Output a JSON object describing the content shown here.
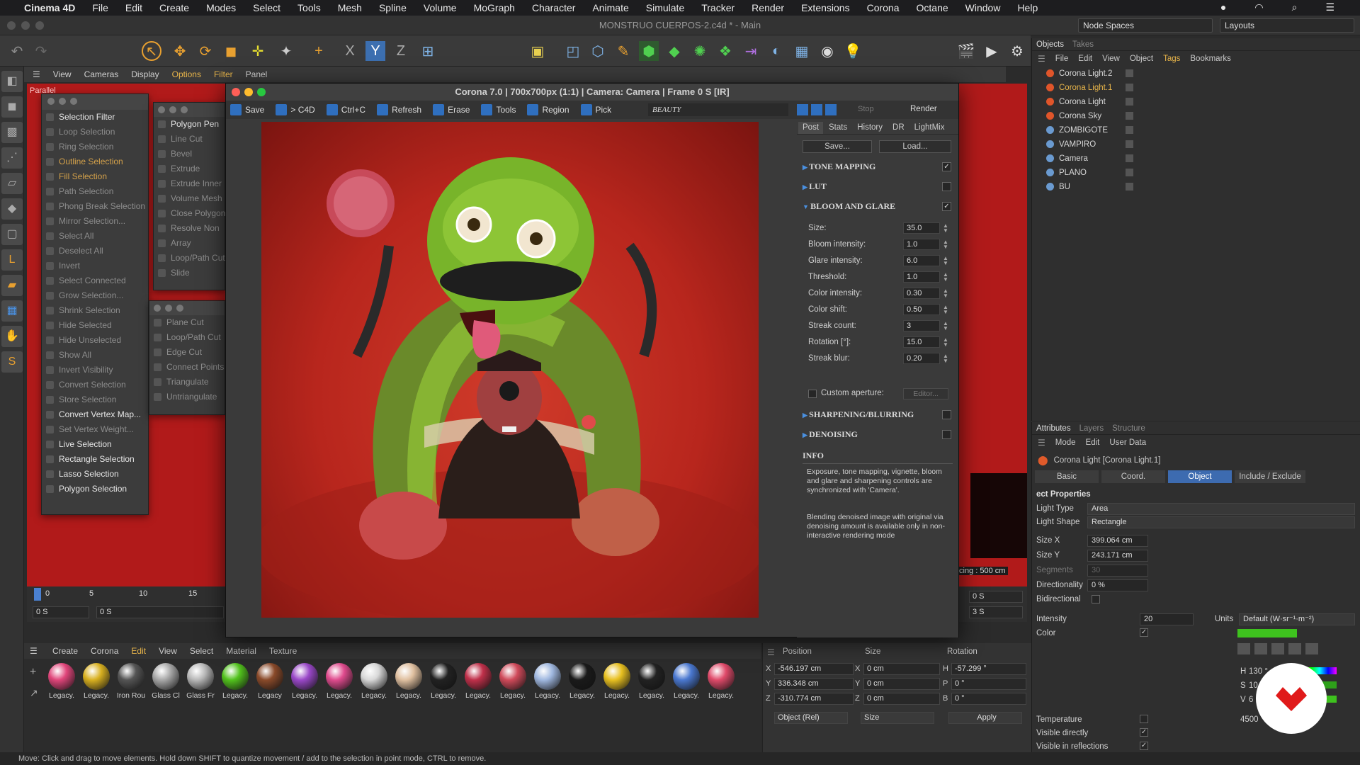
{
  "menubar": {
    "apple": "",
    "app": "Cinema 4D",
    "items": [
      "File",
      "Edit",
      "Create",
      "Modes",
      "Select",
      "Tools",
      "Mesh",
      "Spline",
      "Volume",
      "MoGraph",
      "Character",
      "Animate",
      "Simulate",
      "Tracker",
      "Render",
      "Extensions",
      "Corona",
      "Octane",
      "Window",
      "Help"
    ]
  },
  "window": {
    "title": "MONSTRUO CUERPOS-2.c4d * - Main",
    "node_spaces": "Node Spaces",
    "layouts": "Layouts"
  },
  "viewport_menu": [
    "View",
    "Cameras",
    "Display",
    "Options",
    "Filter",
    "Panel"
  ],
  "viewport": {
    "label": "Parallel",
    "grid_spacing": "cing : 500 cm"
  },
  "select_panel": {
    "items": [
      {
        "label": "Selection Filter",
        "state": "on"
      },
      {
        "label": "Loop Selection",
        "state": "off"
      },
      {
        "label": "Ring Selection",
        "state": "off"
      },
      {
        "label": "Outline Selection",
        "state": "hl"
      },
      {
        "label": "Fill Selection",
        "state": "hl"
      },
      {
        "label": "Path Selection",
        "state": "off"
      },
      {
        "label": "Phong Break Selection",
        "state": "off"
      },
      {
        "label": "Mirror Selection...",
        "state": "off"
      },
      {
        "label": "Select All",
        "state": "off"
      },
      {
        "label": "Deselect All",
        "state": "off"
      },
      {
        "label": "Invert",
        "state": "off"
      },
      {
        "label": "Select Connected",
        "state": "off"
      },
      {
        "label": "Grow Selection...",
        "state": "off"
      },
      {
        "label": "Shrink Selection",
        "state": "off"
      },
      {
        "label": "Hide Selected",
        "state": "off"
      },
      {
        "label": "Hide Unselected",
        "state": "off"
      },
      {
        "label": "Show All",
        "state": "off"
      },
      {
        "label": "Invert Visibility",
        "state": "off"
      },
      {
        "label": "Convert Selection",
        "state": "off"
      },
      {
        "label": "Store Selection",
        "state": "off"
      },
      {
        "label": "Convert Vertex Map...",
        "state": "on"
      },
      {
        "label": "Set Vertex Weight...",
        "state": "off"
      },
      {
        "label": "Live Selection",
        "state": "on"
      },
      {
        "label": "Rectangle Selection",
        "state": "on"
      },
      {
        "label": "Lasso Selection",
        "state": "on"
      },
      {
        "label": "Polygon Selection",
        "state": "on"
      }
    ]
  },
  "mesh_panel": {
    "items": [
      "Polygon Pen",
      "Line Cut",
      "Bevel",
      "Extrude",
      "Extrude Inner",
      "Volume Mesh",
      "Close Polygon",
      "Resolve Non",
      "Array",
      "Loop/Path Cut",
      "Slide"
    ]
  },
  "mesh_panel2": {
    "items": [
      "Plane Cut",
      "Loop/Path Cut",
      "Edge Cut",
      "Connect Points",
      "Triangulate",
      "Untriangulate"
    ]
  },
  "timeline": {
    "ticks": [
      "0",
      "5",
      "10",
      "15"
    ],
    "start": "0 S",
    "current": "0 S",
    "end_a": "0 S",
    "end_b": "3 S"
  },
  "material_menu": [
    "Create",
    "Corona",
    "Edit",
    "View",
    "Select",
    "Material",
    "Texture"
  ],
  "materials": [
    {
      "label": "Legacy.",
      "color": "#e0457a"
    },
    {
      "label": "Legacy.",
      "color": "#d8b020"
    },
    {
      "label": "Iron Rou",
      "color": "#555555"
    },
    {
      "label": "Glass Cl",
      "color": "#a8a8a8"
    },
    {
      "label": "Glass Fr",
      "color": "#b8b8b8"
    },
    {
      "label": "Legacy.",
      "color": "#52c21d"
    },
    {
      "label": "Legacy",
      "color": "#8a4a2a"
    },
    {
      "label": "Legacy.",
      "color": "#9a48c8"
    },
    {
      "label": "Legacy.",
      "color": "#e04b8e"
    },
    {
      "label": "Legacy.",
      "color": "#d8d8d8"
    },
    {
      "label": "Legacy.",
      "color": "#e0c0a0"
    },
    {
      "label": "Legacy.",
      "color": "#222222"
    },
    {
      "label": "Legacy.",
      "color": "#c0304a"
    },
    {
      "label": "Legacy.",
      "color": "#d04a5a"
    },
    {
      "label": "Legacy.",
      "color": "#a0b8e0"
    },
    {
      "label": "Legacy.",
      "color": "#1a1a1a"
    },
    {
      "label": "Legacy.",
      "color": "#e8c020"
    },
    {
      "label": "Legacy.",
      "color": "#222222"
    },
    {
      "label": "Legacy.",
      "color": "#4a78d0"
    },
    {
      "label": "Legacy.",
      "color": "#e04a6a"
    }
  ],
  "coords": {
    "headers": [
      "Position",
      "Size",
      "Rotation"
    ],
    "x": "-546.197 cm",
    "y": "336.348 cm",
    "z": "-310.774 cm",
    "sx": "0 cm",
    "sy": "0 cm",
    "sz": "0 cm",
    "h": "-57.299 °",
    "p": "0 °",
    "b": "0 °",
    "mode": "Object (Rel)",
    "size_mode": "Size",
    "apply": "Apply",
    "labels": {
      "x": "X",
      "y": "Y",
      "z": "Z",
      "h": "H",
      "p": "P",
      "b": "B"
    }
  },
  "status": "Move: Click and drag to move elements. Hold down SHIFT to quantize movement / add to the selection in point mode, CTRL to remove.",
  "objects_manager": {
    "tabs": [
      "Objects",
      "Takes"
    ],
    "menu": [
      "File",
      "Edit",
      "View",
      "Object",
      "Tags",
      "Bookmarks"
    ],
    "rows": [
      {
        "label": "Corona Light.2",
        "color": "#d8d8d8"
      },
      {
        "label": "Corona Light.1",
        "color": "#e8b54a"
      },
      {
        "label": "Corona Light",
        "color": "#d8d8d8"
      },
      {
        "label": "Corona Sky",
        "color": "#d8d8d8"
      },
      {
        "label": "ZOMBIGOTE",
        "color": "#d8d8d8"
      },
      {
        "label": "VAMPIRO",
        "color": "#d8d8d8"
      },
      {
        "label": "Camera",
        "color": "#d8d8d8"
      },
      {
        "label": "PLANO",
        "color": "#d8d8d8"
      },
      {
        "label": "BU",
        "color": "#d8d8d8"
      }
    ]
  },
  "attributes": {
    "tabs": [
      "Attributes",
      "Layers",
      "Structure"
    ],
    "menu": [
      "Mode",
      "Edit",
      "User Data"
    ],
    "object_title": "Corona Light [Corona Light.1]",
    "subtabs": [
      "Basic",
      "Coord.",
      "Object",
      "Include / Exclude"
    ],
    "section": "ect Properties",
    "light_type_label": "Light Type",
    "light_type": "Area",
    "light_shape_label": "Light Shape",
    "light_shape": "Rectangle",
    "size_x_label": "Size X",
    "size_x": "399.064 cm",
    "size_y_label": "Size Y",
    "size_y": "243.171 cm",
    "segments_label": "Segments",
    "segments": "30",
    "directionality_label": "Directionality",
    "directionality": "0 %",
    "bidirectional_label": "Bidirectional",
    "intensity_label": "Intensity",
    "intensity": "20",
    "units_label": "Units",
    "units": "Default (W·sr⁻¹·m⁻²)",
    "color_label": "Color",
    "h_label": "H",
    "h_val": "130 °",
    "s_label": "S",
    "s_val": "10",
    "v_label": "V",
    "v_val": "6",
    "temperature_label": "Temperature",
    "temperature": "4500",
    "visible_directly_label": "Visible directly",
    "visible_reflections_label": "Visible in reflections",
    "color_swatch": "#3ec21e"
  },
  "vfb": {
    "title": "Corona 7.0 | 700x700px (1:1) | Camera: Camera | Frame 0 S [IR]",
    "toolbar": [
      "Save",
      "> C4D",
      "Ctrl+C",
      "Refresh",
      "Erase",
      "Tools",
      "Region",
      "Pick"
    ],
    "channel": "BEAUTY",
    "stop": "Stop",
    "render": "Render",
    "post_tabs": [
      "Post",
      "Stats",
      "History",
      "DR",
      "LightMix"
    ],
    "save_btn": "Save...",
    "load_btn": "Load...",
    "sections": {
      "tone": "TONE MAPPING",
      "lut": "LUT",
      "bloom": "BLOOM AND GLARE",
      "sharp": "SHARPENING/BLURRING",
      "denoise": "DENOISING",
      "info": "INFO"
    },
    "bloom": [
      {
        "label": "Size:",
        "value": "35.0"
      },
      {
        "label": "Bloom intensity:",
        "value": "1.0"
      },
      {
        "label": "Glare intensity:",
        "value": "6.0"
      },
      {
        "label": "Threshold:",
        "value": "1.0"
      },
      {
        "label": "Color intensity:",
        "value": "0.30"
      },
      {
        "label": "Color shift:",
        "value": "0.50"
      },
      {
        "label": "Streak count:",
        "value": "3"
      },
      {
        "label": "Rotation [°]:",
        "value": "15.0"
      },
      {
        "label": "Streak blur:",
        "value": "0.20"
      }
    ],
    "custom_aperture": "Custom aperture:",
    "editor": "Editor...",
    "info1": "Exposure, tone mapping, vignette, bloom and glare and sharpening controls are synchronized with 'Camera'.",
    "info2": "Blending denoised image with original via denoising amount is available only in non-interactive rendering mode"
  }
}
